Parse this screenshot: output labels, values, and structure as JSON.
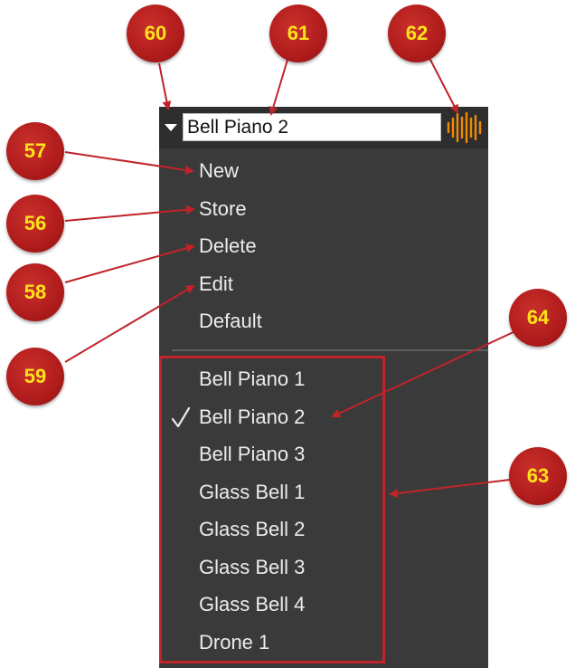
{
  "preset_bar": {
    "current_preset": "Bell Piano 2",
    "dropdown_icon": "triangle-down-icon",
    "waveform_icon": "waveform-icon",
    "accent_color": "#f28a00"
  },
  "menu": {
    "actions": [
      "New",
      "Store",
      "Delete",
      "Edit",
      "Default"
    ],
    "presets": [
      "Bell Piano 1",
      "Bell Piano 2",
      "Bell Piano 3",
      "Glass Bell 1",
      "Glass Bell 2",
      "Glass Bell 3",
      "Glass Bell 4",
      "Drone 1"
    ],
    "checked_preset": "Bell Piano 2",
    "checkmark": "✓"
  },
  "callouts": {
    "c60": "60",
    "c61": "61",
    "c62": "62",
    "c57": "57",
    "c56": "56",
    "c58": "58",
    "c59": "59",
    "c64": "64",
    "c63": "63"
  },
  "annotation_color": "#c0232a"
}
